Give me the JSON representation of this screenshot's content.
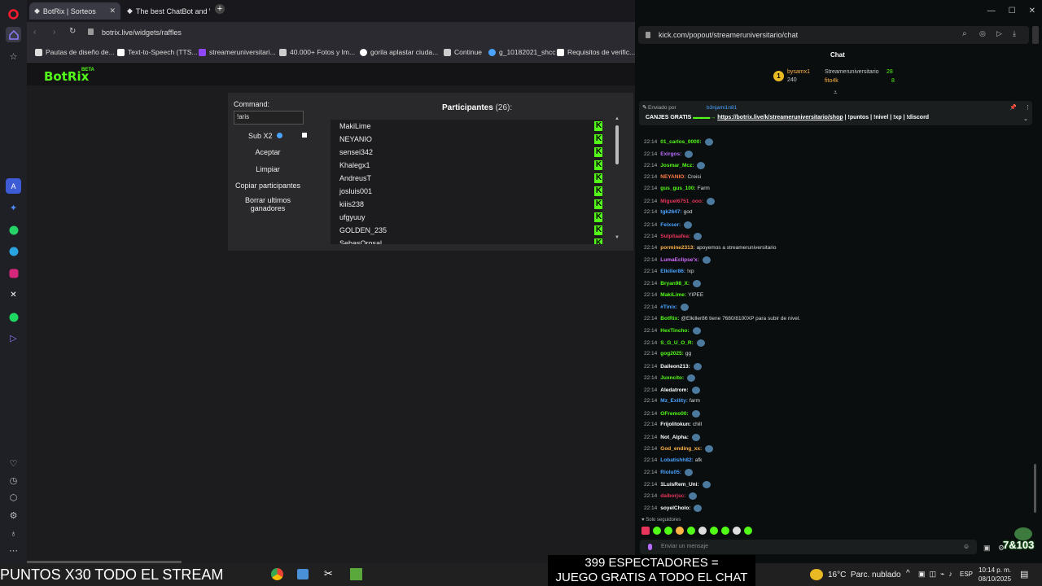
{
  "tabs": [
    {
      "title": "BotRix | Sorteos"
    },
    {
      "title": "The best ChatBot and Wid"
    }
  ],
  "address": "botrix.live/widgets/raffles",
  "bookmarks": [
    "Pautas de diseño de...",
    "Text-to-Speech (TTS...",
    "streameruniversitari...",
    "40.000+ Fotos y Im...",
    "gorila aplastar ciuda...",
    "Continue",
    "g_10182021_shcc",
    "Requisitos de verific..."
  ],
  "botrix": {
    "logo": "BotRix",
    "beta": "BETA"
  },
  "raffle": {
    "command_label": "Command:",
    "command_value": "!aris",
    "sub_label": "Sub X2",
    "buttons": [
      "Aceptar",
      "Limpiar",
      "Copiar participantes",
      "Borrar ultimos ganadores"
    ],
    "participants_title": "Participantes",
    "participants_count": "(26):",
    "participants": [
      "MakiLime",
      "NEYANIO",
      "sensei342",
      "Khalegx1",
      "AndreusT",
      "josluis001",
      "kiiis238",
      "ufgyuuy",
      "GOLDEN_235",
      "SebasOrosal"
    ],
    "badge": "K"
  },
  "kick": {
    "url": "kick.com/popout/streameruniversitario/chat",
    "chat_title": "Chat",
    "leaders": {
      "first": {
        "name": "bysamx1",
        "value": "240"
      },
      "second": {
        "name": "Streameruniversitario",
        "value": "28"
      },
      "third": {
        "name": "fito4k",
        "value": "8"
      }
    },
    "pinned": {
      "sent_by": "Enviado por",
      "user": "b3njami1n81",
      "text_prefix": "CANJES GRATIS",
      "link": "https://botrix.live/k/streameruniversitario/shop",
      "text_suffix": "| !puntos | !nivel | !xp | !discord"
    },
    "messages": [
      {
        "time": "22:14",
        "user": "01_carlos_0000:",
        "text": "",
        "color": "#53fc18"
      },
      {
        "time": "22:14",
        "user": "Exirgos:",
        "text": "",
        "color": "#b86bff"
      },
      {
        "time": "22:14",
        "user": "Josmar_Mcz:",
        "text": "",
        "color": "#53fc18"
      },
      {
        "time": "22:14",
        "user": "NEYANIO:",
        "text": "Creisi",
        "color": "#ff7a45"
      },
      {
        "time": "22:14",
        "user": "gus_gus_100:",
        "text": "Farm",
        "color": "#53fc18"
      },
      {
        "time": "22:14",
        "user": "Miguel6751_ooo:",
        "text": "",
        "color": "#e8355b"
      },
      {
        "time": "22:14",
        "user": "tgk2647:",
        "text": "god",
        "color": "#4aa3ff"
      },
      {
        "time": "22:14",
        "user": "Feixser:",
        "text": "",
        "color": "#4aa3ff"
      },
      {
        "time": "22:14",
        "user": "Sulpitaafea:",
        "text": "",
        "color": "#e8355b"
      },
      {
        "time": "22:14",
        "user": "pormine2313:",
        "text": "apoyemos a streameruniversitario",
        "color": "#ffb347"
      },
      {
        "time": "22:14",
        "user": "LumaEclipse'x:",
        "text": "",
        "color": "#d36bff"
      },
      {
        "time": "22:14",
        "user": "Elkiller86:",
        "text": "!xp",
        "color": "#4aa3ff"
      },
      {
        "time": "22:14",
        "user": "Bryan98_X:",
        "text": "",
        "color": "#53fc18"
      },
      {
        "time": "22:14",
        "user": "MakiLime:",
        "text": "YIPEE",
        "color": "#53fc18"
      },
      {
        "time": "22:14",
        "user": "#Tinix:",
        "text": "",
        "color": "#4aa3ff"
      },
      {
        "time": "22:14",
        "user": "BotRix:",
        "text": "@Elkiller86 tiene 7680/8100XP para subir de nivel.",
        "color": "#53fc18"
      },
      {
        "time": "22:14",
        "user": "HexTincho:",
        "text": "",
        "color": "#53fc18"
      },
      {
        "time": "22:14",
        "user": "S_G_U_O_R:",
        "text": "",
        "color": "#53fc18"
      },
      {
        "time": "22:14",
        "user": "gog2025:",
        "text": "gg",
        "color": "#53fc18"
      },
      {
        "time": "22:14",
        "user": "Daileon213:",
        "text": "",
        "color": "#ffffff"
      },
      {
        "time": "22:14",
        "user": "Juxncito:",
        "text": "",
        "color": "#53fc18"
      },
      {
        "time": "22:14",
        "user": "Aledatrom:",
        "text": "",
        "color": "#ffffff"
      },
      {
        "time": "22:14",
        "user": "Mz_Exility:",
        "text": "farm",
        "color": "#4aa3ff"
      },
      {
        "time": "22:14",
        "user": "OFremo00:",
        "text": "",
        "color": "#53fc18"
      },
      {
        "time": "22:14",
        "user": "Frijolitokun:",
        "text": "chill",
        "color": "#ffffff"
      },
      {
        "time": "22:14",
        "user": "Not_Alpha:",
        "text": "",
        "color": "#ffffff"
      },
      {
        "time": "22:14",
        "user": "God_ending_xx:",
        "text": "",
        "color": "#ffb347"
      },
      {
        "time": "22:14",
        "user": "Lobatishh82:",
        "text": "afk",
        "color": "#4aa3ff"
      },
      {
        "time": "22:14",
        "user": "Riolu05:",
        "text": "",
        "color": "#4aa3ff"
      },
      {
        "time": "22:14",
        "user": "1LuisRem_Uni:",
        "text": "",
        "color": "#ffffff"
      },
      {
        "time": "22:14",
        "user": "daiborjsc:",
        "text": "",
        "color": "#e8355b"
      },
      {
        "time": "22:14",
        "user": "soyelCholo:",
        "text": "",
        "color": "#ffffff"
      }
    ],
    "followers_only": "Solo seguidores",
    "input_placeholder": "Enviar un mensaje",
    "counter": "7&103"
  },
  "overlay": {
    "left_banner": "PUNTOS X30 TODO EL STREAM",
    "viewers_line1": "399 ESPECTADORES =",
    "viewers_line2": "JUEGO GRATIS A TODO EL CHAT"
  },
  "taskbar": {
    "weather": "16°C  Parc. nublado",
    "lang": "ESP",
    "time": "10:14 p. m.",
    "date": "08/10/2025"
  }
}
